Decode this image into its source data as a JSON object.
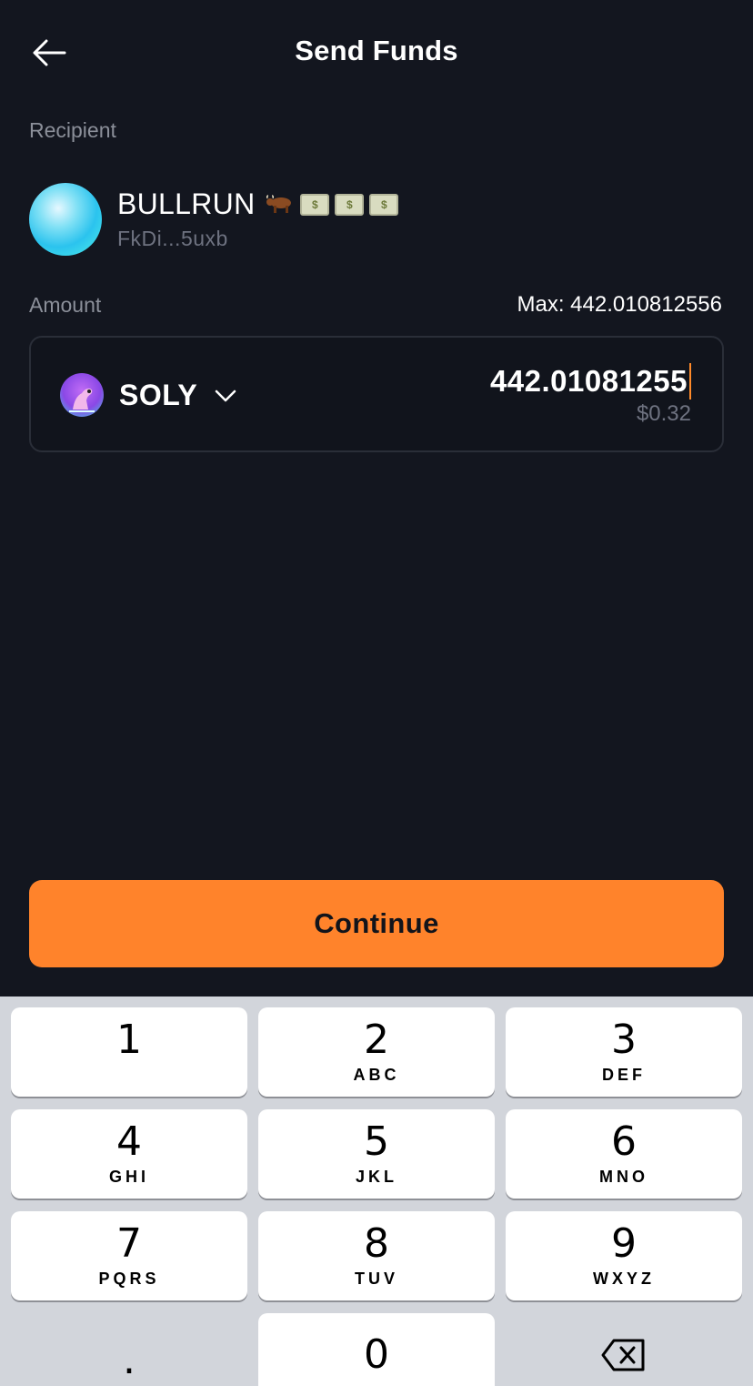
{
  "header": {
    "title": "Send Funds"
  },
  "recipient": {
    "label": "Recipient",
    "name": "BULLRUN",
    "address": "FkDi...5uxb"
  },
  "amount": {
    "label": "Amount",
    "max_text": "Max: 442.010812556",
    "token": "SOLY",
    "value": "442.01081255",
    "fiat": "$0.32"
  },
  "continue_label": "Continue",
  "keyboard": {
    "keys": [
      {
        "num": "1",
        "letters": ""
      },
      {
        "num": "2",
        "letters": "ABC"
      },
      {
        "num": "3",
        "letters": "DEF"
      },
      {
        "num": "4",
        "letters": "GHI"
      },
      {
        "num": "5",
        "letters": "JKL"
      },
      {
        "num": "6",
        "letters": "MNO"
      },
      {
        "num": "7",
        "letters": "PQRS"
      },
      {
        "num": "8",
        "letters": "TUV"
      },
      {
        "num": "9",
        "letters": "WXYZ"
      },
      {
        "num": ".",
        "letters": ""
      },
      {
        "num": "0",
        "letters": ""
      }
    ]
  },
  "colors": {
    "background": "#13161f",
    "accent": "#ff832b",
    "muted_text": "#8b8f99",
    "keyboard_bg": "#d2d5db"
  }
}
